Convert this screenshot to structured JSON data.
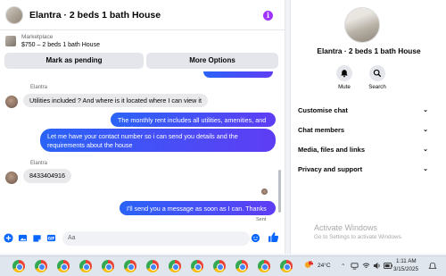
{
  "chat": {
    "title": "Elantra · 2 beds 1 bath House",
    "marketplace_label": "Marketplace",
    "listing": "$750 – 2 beds 1 bath House",
    "mark_pending_label": "Mark as pending",
    "more_options_label": "More Options",
    "messages": {
      "sender_1": "Elantra",
      "incoming_1": "Utilities included ? And where is it located where I can view it",
      "outgoing_1": "The monthly rent includes all utilities, amenities, and Wi-Fi.",
      "outgoing_2": "Let me have your contact number so i can send you details and the requirements about the house",
      "sender_2": "Elantra",
      "incoming_2": "8433404916",
      "outgoing_3": "I'll send you a message as soon as I can. Thanks",
      "status": "Sent"
    },
    "composer": {
      "placeholder": "Aa"
    }
  },
  "info_panel": {
    "name": "Elantra · 2 beds 1 bath House",
    "actions": {
      "mute_label": "Mute",
      "search_label": "Search"
    },
    "sections": [
      "Customise chat",
      "Chat members",
      "Media, files and links",
      "Privacy and support"
    ],
    "watermark_title": "Activate Windows",
    "watermark_sub": "Go to Settings to activate Windows."
  },
  "taskbar": {
    "weather_badge": "1",
    "temperature": "24°C",
    "time": "1:11 AM",
    "date": "3/15/2025"
  },
  "colors": {
    "accent": "#a033ff",
    "bubble_out_start": "#2a63f6",
    "bubble_out_end": "#5f3df5",
    "link_blue": "#0866ff"
  },
  "icons": [
    "info-icon",
    "plus-icon",
    "image-icon",
    "sticker-icon",
    "gif-icon",
    "emoji-icon",
    "thumbs-up-icon",
    "bell-icon",
    "search-icon",
    "chevron-down-icon",
    "chrome-icon",
    "wifi-icon",
    "speaker-icon",
    "battery-icon"
  ]
}
